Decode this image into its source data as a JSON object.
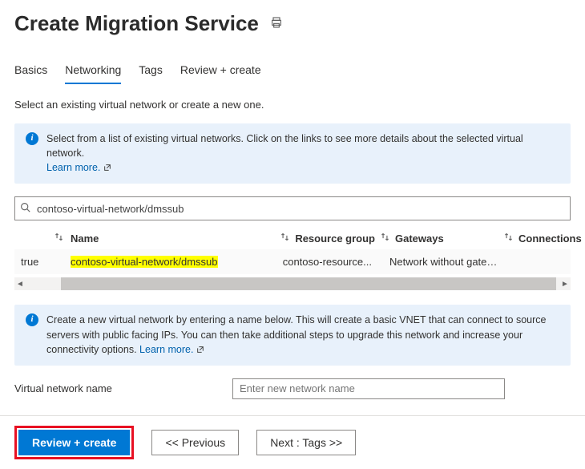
{
  "page_title": "Create Migration Service",
  "tabs": {
    "basics": "Basics",
    "networking": "Networking",
    "tags": "Tags",
    "review": "Review + create",
    "active": "networking"
  },
  "subhead": "Select an existing virtual network or create a new one.",
  "info_existing": {
    "text": "Select from a list of existing virtual networks. Click on the links to see more details about the selected virtual network.",
    "learn_more": "Learn more."
  },
  "search": {
    "value": "contoso-virtual-network/dmssub"
  },
  "columns": {
    "name": "Name",
    "resource_group": "Resource group",
    "gateways": "Gateways",
    "connections": "Connections"
  },
  "rows": [
    {
      "prefix": "true",
      "name": "contoso-virtual-network/dmssub",
      "resource_group": "contoso-resource...",
      "gateways": "Network without gateway",
      "connections": ""
    }
  ],
  "info_new": {
    "text": "Create a new virtual network by entering a name below. This will create a basic VNET that can connect to source servers with public facing IPs. You can then take additional steps to upgrade this network and increase your connectivity options.",
    "learn_more": "Learn more."
  },
  "vnet_name_label": "Virtual network name",
  "vnet_name_placeholder": "Enter new network name",
  "footer": {
    "review": "Review + create",
    "previous": "<<  Previous",
    "next": "Next : Tags >>"
  }
}
